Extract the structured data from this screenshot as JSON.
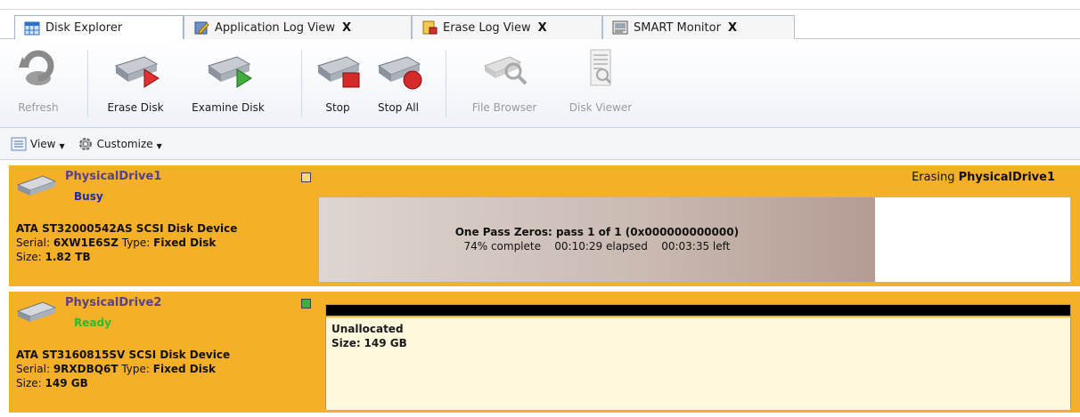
{
  "tabs": [
    {
      "label": "Disk Explorer",
      "active": true,
      "icon": "grid-icon"
    },
    {
      "label": "Application Log View",
      "closable": true,
      "icon": "log-pencil-icon"
    },
    {
      "label": "Erase Log View",
      "closable": true,
      "icon": "erase-log-icon"
    },
    {
      "label": "SMART Monitor",
      "closable": true,
      "icon": "monitor-icon"
    }
  ],
  "close_glyph": "X",
  "ribbon": {
    "refresh": "Refresh",
    "erase_disk": "Erase Disk",
    "examine_disk": "Examine Disk",
    "stop": "Stop",
    "stop_all": "Stop All",
    "file_browser": "File Browser",
    "disk_viewer": "Disk Viewer"
  },
  "subbar": {
    "view": "View",
    "customize": "Customize"
  },
  "drives": [
    {
      "name": "PhysicalDrive1",
      "status": "Busy",
      "status_color": "#1b2aa8",
      "model": "ATA ST32000542AS SCSI Disk Device",
      "serial_label": "Serial:",
      "serial": "6XW1E6SZ",
      "type_label": "Type:",
      "type": "Fixed Disk",
      "size_label": "Size:",
      "size": "1.82 TB",
      "header_prefix": "Erasing",
      "header_name": "PhysicalDrive1",
      "progress_line1": "One Pass Zeros: pass 1 of 1 (0x000000000000)",
      "progress_percent": "74% complete",
      "progress_elapsed": "00:10:29 elapsed",
      "progress_left": "00:03:35 left",
      "progress_fraction": 0.74
    },
    {
      "name": "PhysicalDrive2",
      "status": "Ready",
      "status_color": "#2dbb2d",
      "model": "ATA ST3160815SV SCSI Disk Device",
      "serial_label": "Serial:",
      "serial": "9RXDBQ6T",
      "type_label": "Type:",
      "type": "Fixed Disk",
      "size_label": "Size:",
      "size": "149 GB",
      "partition_label": "Unallocated",
      "partition_size_label": "Size:",
      "partition_size": "149 GB"
    }
  ],
  "colors": {
    "drive_bg": "#f5b027",
    "unallocated_bg": "#fff8dc"
  }
}
